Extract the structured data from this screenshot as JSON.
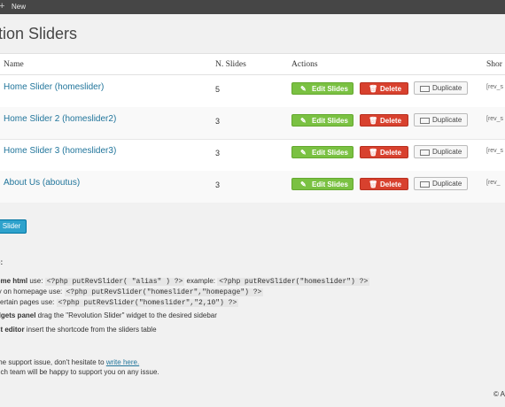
{
  "adminbar": {
    "plus": "+",
    "new_label": "New"
  },
  "page_title": "tion Sliders",
  "table": {
    "columns": {
      "name": "Name",
      "slides": "N. Slides",
      "actions": "Actions",
      "shortcode": "Shor"
    },
    "rows": [
      {
        "name": "Home Slider (homeslider)",
        "slides": "5",
        "shortcode": "[rev_s"
      },
      {
        "name": "Home Slider 2 (homeslider2)",
        "slides": "3",
        "shortcode": "[rev_s"
      },
      {
        "name": "Home Slider 3 (homeslider3)",
        "slides": "3",
        "shortcode": "[rev_s"
      },
      {
        "name": "About Us (aboutus)",
        "slides": "3",
        "shortcode": "[rev_"
      }
    ],
    "edit_label": "Edit Slides",
    "delete_label": "Delete",
    "duplicate_label": "Duplicate"
  },
  "create_button": "Slider",
  "help": {
    "heading": "e:",
    "line1_bold": "eme html",
    "line1_text": " use: ",
    "line1_code": "<?php putRevSlider( \"alias\" ) ?>",
    "line1_text2": " example: ",
    "line1_code2": "<?php putRevSlider(\"homeslider\") ?>",
    "line2_text": "ly on homepage use: ",
    "line2_code": "<?php putRevSlider(\"homeslider\",\"homepage\") ?>",
    "line3_text": " certain pages use: ",
    "line3_code": "<?php putRevSlider(\"homeslider\",\"2,10\") ?>",
    "line4_bold": "dgets panel",
    "line4_text": " drag the \"Revolution Slider\" widget to the desired sidebar",
    "line5_bold": "st editor",
    "line5_text": " insert the shortcode from the sliders table",
    "support_text": "me support issue, don't hesitate to ",
    "support_link": "write here.",
    "support_text2": "nch team will be happy to support you on any issue."
  },
  "footer": {
    "copyright": "© A"
  },
  "colors": {
    "edit": "#7ac142",
    "delete": "#d8412e",
    "primary": "#2ea2cc",
    "link": "#21759b"
  }
}
